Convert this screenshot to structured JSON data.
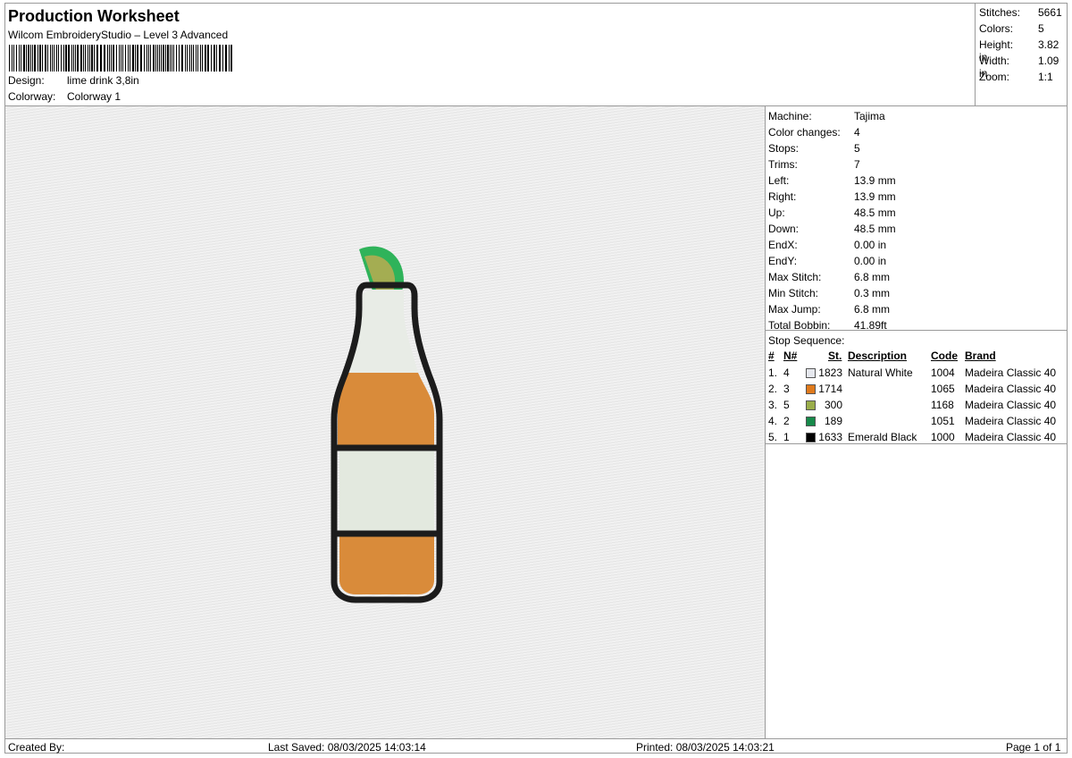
{
  "header": {
    "title": "Production Worksheet",
    "subtitle": "Wilcom EmbroideryStudio – Level 3 Advanced",
    "design_label": "Design:",
    "design_value": "lime drink 3,8in",
    "colorway_label": "Colorway:",
    "colorway_value": "Colorway 1"
  },
  "stats": [
    {
      "label": "Stitches:",
      "value": "5661"
    },
    {
      "label": "Colors:",
      "value": "5"
    },
    {
      "label": "Height:",
      "value": "3.82 in"
    },
    {
      "label": "Width:",
      "value": "1.09 in"
    },
    {
      "label": "Zoom:",
      "value": "1:1"
    }
  ],
  "machine_info": [
    {
      "label": "Machine:",
      "value": "Tajima"
    },
    {
      "label": "Color changes:",
      "value": "4"
    },
    {
      "label": "Stops:",
      "value": "5"
    },
    {
      "label": "Trims:",
      "value": "7"
    },
    {
      "label": "Left:",
      "value": "13.9 mm"
    },
    {
      "label": "Right:",
      "value": "13.9 mm"
    },
    {
      "label": "Up:",
      "value": "48.5 mm"
    },
    {
      "label": "Down:",
      "value": "48.5 mm"
    },
    {
      "label": "EndX:",
      "value": "0.00 in"
    },
    {
      "label": "EndY:",
      "value": "0.00 in"
    },
    {
      "label": "Max Stitch:",
      "value": "6.8 mm"
    },
    {
      "label": "Min Stitch:",
      "value": "0.3 mm"
    },
    {
      "label": "Max Jump:",
      "value": "6.8 mm"
    },
    {
      "label": "Total Bobbin:",
      "value": "41.89ft"
    }
  ],
  "stop_sequence": {
    "title": "Stop Sequence:",
    "headers": {
      "idx": "#",
      "n": "N#",
      "st": "St.",
      "description": "Description",
      "code": "Code",
      "brand": "Brand"
    },
    "rows": [
      {
        "idx": "1.",
        "n": "4",
        "color": "#e6e8ee",
        "st": "1823",
        "description": "Natural White",
        "code": "1004",
        "brand": "Madeira Classic 40"
      },
      {
        "idx": "2.",
        "n": "3",
        "color": "#e07a1c",
        "st": "1714",
        "description": "",
        "code": "1065",
        "brand": "Madeira Classic 40"
      },
      {
        "idx": "3.",
        "n": "5",
        "color": "#9aad4a",
        "st": "300",
        "description": "",
        "code": "1168",
        "brand": "Madeira Classic 40"
      },
      {
        "idx": "4.",
        "n": "2",
        "color": "#16894a",
        "st": "189",
        "description": "",
        "code": "1051",
        "brand": "Madeira Classic 40"
      },
      {
        "idx": "5.",
        "n": "1",
        "color": "#000000",
        "st": "1633",
        "description": "Emerald Black",
        "code": "1000",
        "brand": "Madeira Classic 40"
      }
    ]
  },
  "footer": {
    "created_by": "Created By:",
    "last_saved": "Last Saved: 08/03/2025 14:03:14",
    "printed": "Printed: 08/03/2025 14:03:21",
    "page": "Page 1 of 1"
  },
  "design_image": {
    "icons": [
      "lime-wedge-icon",
      "bottle-icon"
    ],
    "colors": {
      "outline": "#1c1c1c",
      "liquid": "#d98b3a",
      "label": "#e3e9df",
      "neck": "#e8ece6",
      "lime_rind": "#2fb35a",
      "lime_flesh": "#a4ad52"
    }
  }
}
